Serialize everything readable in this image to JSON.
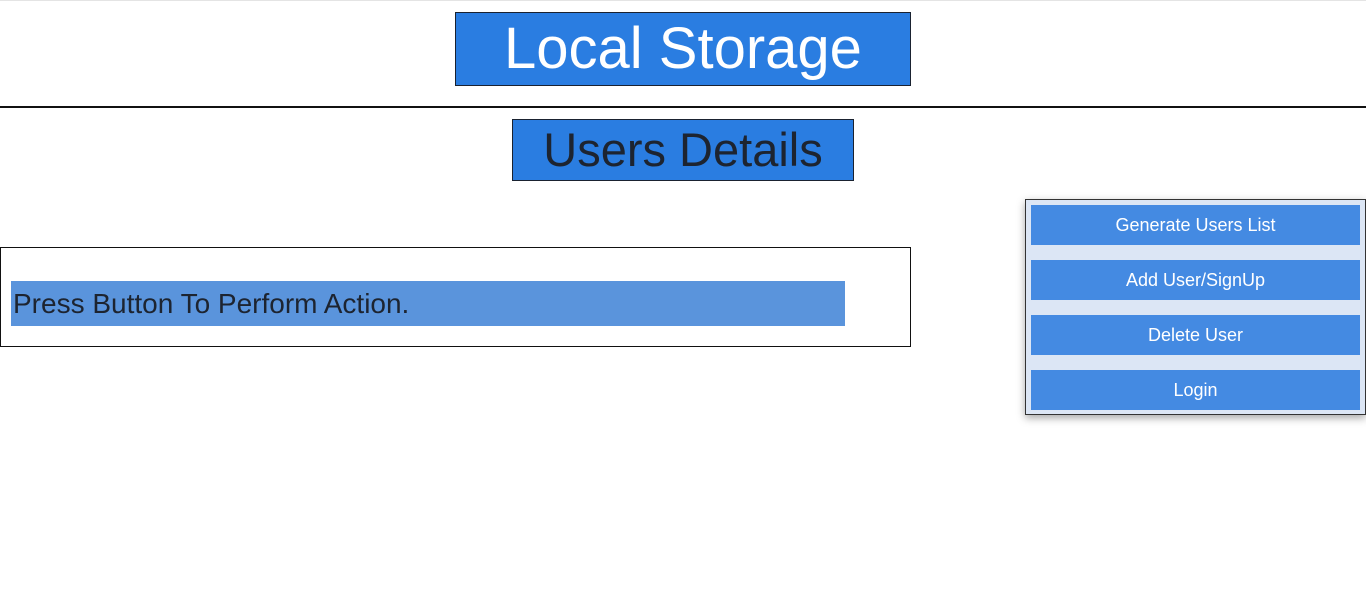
{
  "header": {
    "title": "Local Storage"
  },
  "section": {
    "title": "Users Details"
  },
  "output": {
    "message": "Press Button To Perform Action."
  },
  "actions": [
    {
      "label": "Generate Users List"
    },
    {
      "label": "Add User/SignUp"
    },
    {
      "label": "Delete User"
    },
    {
      "label": "Login"
    }
  ],
  "colors": {
    "title_background": "#2a7de1",
    "button_background": "#448ae2",
    "message_background": "#5a94dc",
    "panel_background": "#dce6f5"
  }
}
